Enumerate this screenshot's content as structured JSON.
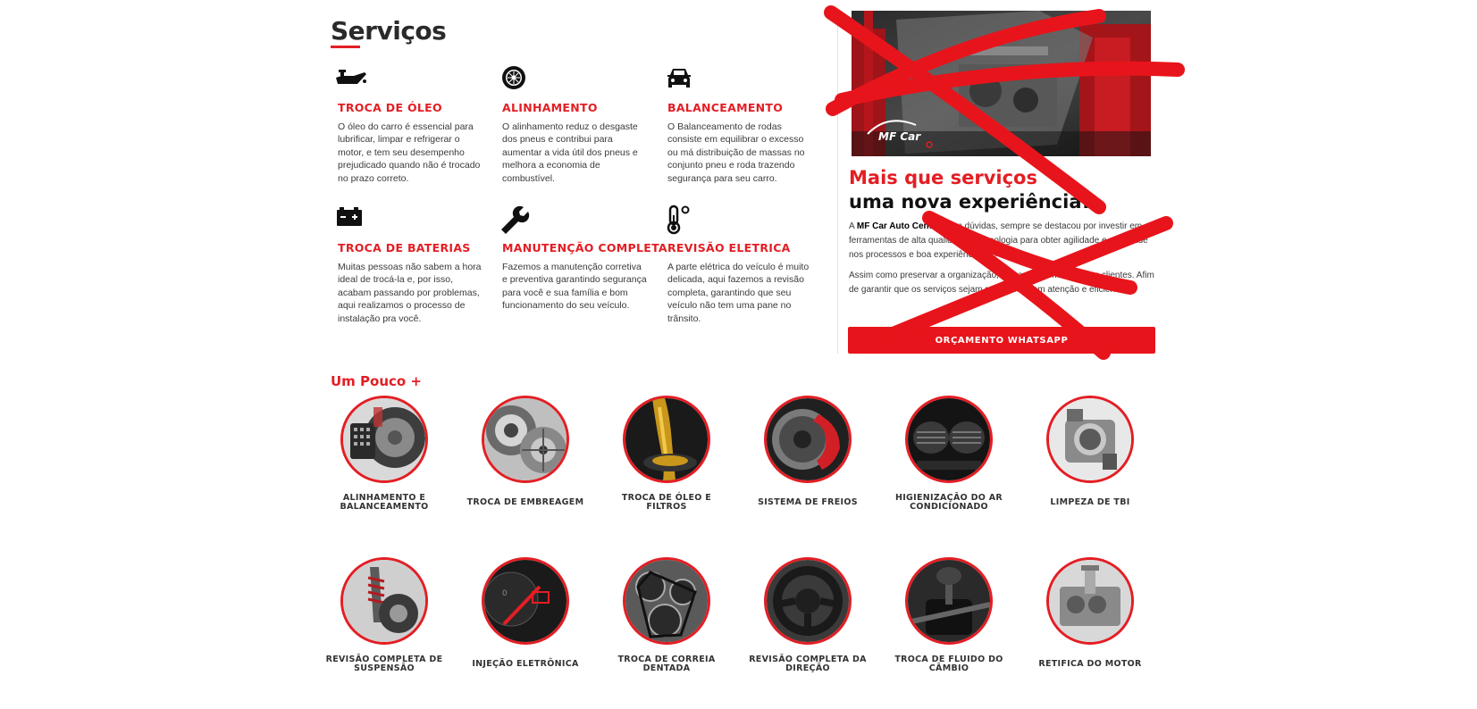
{
  "servicos": {
    "title": "Serviços",
    "items": [
      {
        "icon": "oil-can-icon",
        "title": "TROCA DE ÓLEO",
        "text": "O óleo do carro é essencial para lubrificar, limpar e refrigerar o motor, e tem seu desempenho prejudicado quando não é trocado no prazo correto."
      },
      {
        "icon": "tire-icon",
        "title": "ALINHAMENTO",
        "text": "O alinhamento reduz o desgaste dos pneus e contribui para aumentar a vida útil dos pneus e melhora a economia de combustível."
      },
      {
        "icon": "car-front-icon",
        "title": "BALANCEAMENTO",
        "text": "O Balanceamento de rodas consiste em equilibrar o excesso ou má distribuição de massas no conjunto pneu e roda trazendo segurança para seu carro."
      },
      {
        "icon": "battery-icon",
        "title": "TROCA DE BATERIAS",
        "text": "Muitas pessoas não sabem a hora ideal de trocá-la e, por isso, acabam passando por problemas, aqui realizamos o processo de instalação pra você."
      },
      {
        "icon": "wrench-icon",
        "title": "MANUTENÇÃO COMPLETA",
        "text": "Fazemos a manutenção corretiva e preventiva garantindo segurança para você e sua família e bom funcionamento do seu veículo."
      },
      {
        "icon": "thermometer-icon",
        "title": "REVISÃO ELETRICA",
        "text": "A parte elétrica do veículo é muito delicada, aqui fazemos a revisão completa, garantindo que seu veículo não tem uma pane no trânsito."
      }
    ]
  },
  "promo": {
    "logo_text": "MF Car",
    "headline_red": "Mais que serviços",
    "headline_dark": "uma nova experiência!",
    "p1_prefix": "A ",
    "p1_brand": "MF Car Auto Center",
    "p1_rest": ", sem dúvidas, sempre se destacou por investir em ferramentas de alta qualidade e tecnologia para obter agilidade e qualidade nos processos e boa experiência dos clientes.",
    "p2": "Assim como preservar a organização, limpeza e bem-estar dos clientes. Afim de garantir que os serviços sejam realizados com atenção e eficiência.",
    "button_label": "ORÇAMENTO WHATSAPP",
    "accent_color": "#e31e24"
  },
  "pouco": {
    "title": "Um Pouco +",
    "items": [
      {
        "label": "ALINHAMENTO E BALANCEAMENTO"
      },
      {
        "label": "TROCA DE EMBREAGEM"
      },
      {
        "label": "TROCA DE ÓLEO E FILTROS"
      },
      {
        "label": "SISTEMA DE FREIOS"
      },
      {
        "label": "HIGIENIZAÇÃO DO AR CONDICIONADO"
      },
      {
        "label": "LIMPEZA DE TBI"
      },
      {
        "label": "REVISÃO COMPLETA DE SUSPENSÃO"
      },
      {
        "label": "INJEÇÃO ELETRÔNICA"
      },
      {
        "label": "TROCA DE CORREIA DENTADA"
      },
      {
        "label": "REVISÃO COMPLETA DA DIREÇÃO"
      },
      {
        "label": "TROCA DE FLUIDO DO CÂMBIO"
      },
      {
        "label": "RETIFICA DO MOTOR"
      }
    ]
  }
}
